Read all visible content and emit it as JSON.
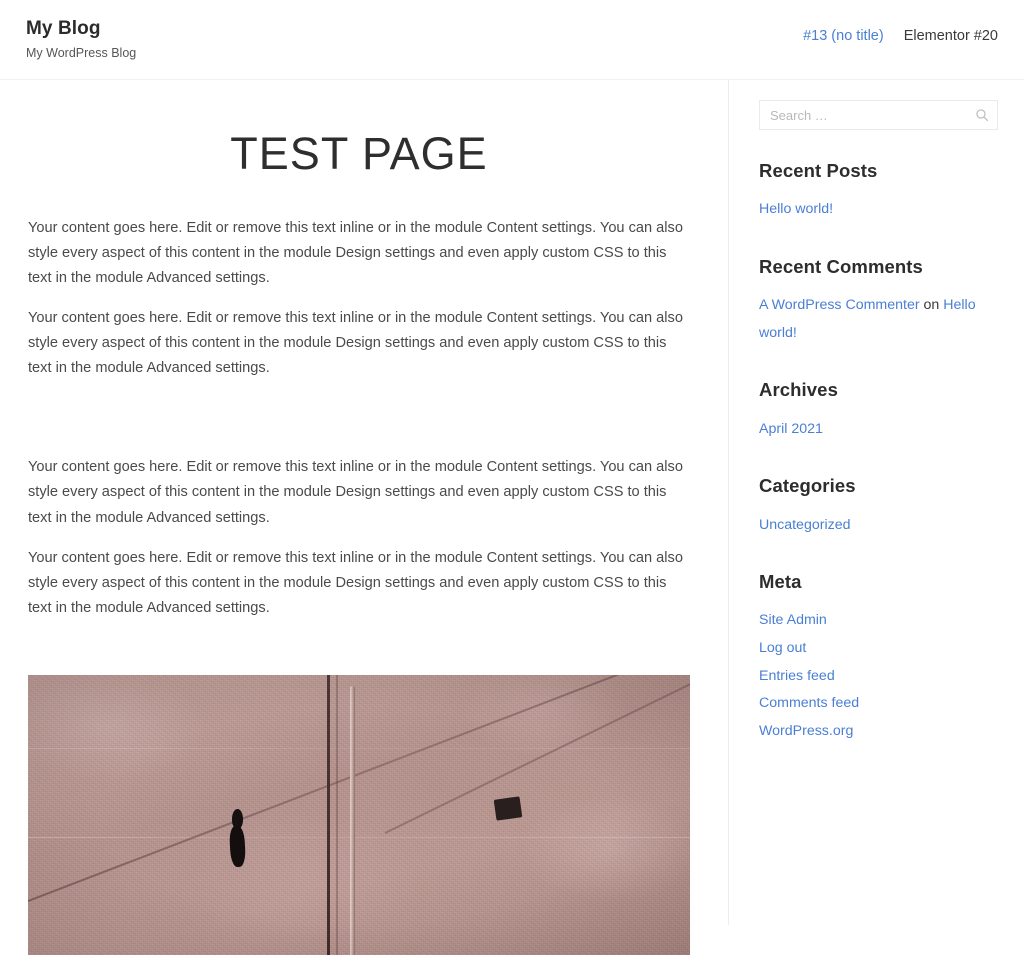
{
  "header": {
    "site_title": "My Blog",
    "tagline": "My WordPress Blog",
    "nav": [
      {
        "label": "#13 (no title)",
        "state": "link"
      },
      {
        "label": "Elementor #20",
        "state": "current"
      }
    ]
  },
  "main": {
    "page_title": "TEST PAGE",
    "paragraphs": [
      "Your content goes here. Edit or remove this text inline or in the module Content settings. You can also style every aspect of this content in the module Design settings and even apply custom CSS to this text in the module Advanced settings.",
      "Your content goes here. Edit or remove this text inline or in the module Content settings. You can also style every aspect of this content in the module Design settings and even apply custom CSS to this text in the module Advanced settings.",
      "Your content goes here. Edit or remove this text inline or in the module Content settings. You can also style every aspect of this content in the module Design settings and even apply custom CSS to this text in the module Advanced settings.",
      "Your content goes here. Edit or remove this text inline or in the module Content settings. You can also style every aspect of this content in the module Design settings and even apply custom CSS to this text in the module Advanced settings."
    ]
  },
  "sidebar": {
    "search": {
      "placeholder": "Search …",
      "value": "",
      "icon": "search-icon"
    },
    "widgets": {
      "recent_posts": {
        "title": "Recent Posts",
        "items": [
          "Hello world!"
        ]
      },
      "recent_comments": {
        "title": "Recent Comments",
        "comment_author": "A WordPress Commenter",
        "separator": " on ",
        "comment_post": "Hello world!"
      },
      "archives": {
        "title": "Archives",
        "items": [
          "April 2021"
        ]
      },
      "categories": {
        "title": "Categories",
        "items": [
          "Uncategorized"
        ]
      },
      "meta": {
        "title": "Meta",
        "items": [
          "Site Admin",
          "Log out",
          "Entries feed",
          "Comments feed",
          "WordPress.org"
        ]
      }
    }
  },
  "colors": {
    "link": "#4a7fd4",
    "text": "#3a3a3a",
    "heading": "#2d2d2d",
    "border": "#ededed",
    "photo_base": "#b8968f"
  }
}
